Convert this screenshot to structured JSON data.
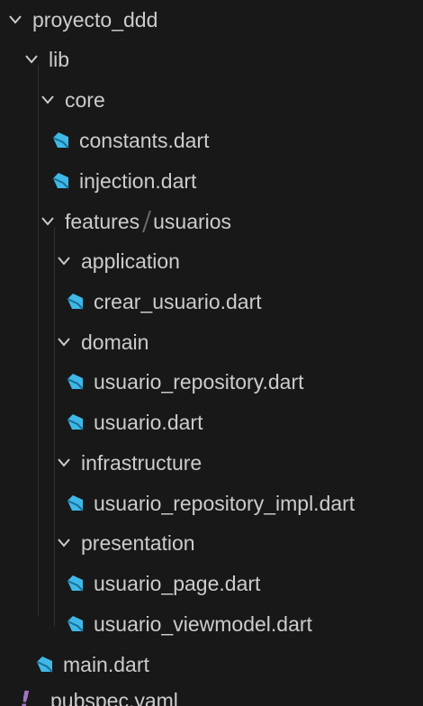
{
  "explorer": {
    "root": {
      "label": "proyecto_ddd"
    },
    "lib": {
      "label": "lib"
    },
    "core": {
      "label": "core"
    },
    "constants": {
      "label": "constants.dart"
    },
    "injection": {
      "label": "injection.dart"
    },
    "features": {
      "label": "features",
      "sub": "usuarios"
    },
    "application": {
      "label": "application"
    },
    "crear_usuario": {
      "label": "crear_usuario.dart"
    },
    "domain": {
      "label": "domain"
    },
    "usuario_repository": {
      "label": "usuario_repository.dart"
    },
    "usuario": {
      "label": "usuario.dart"
    },
    "infrastructure": {
      "label": "infrastructure"
    },
    "usuario_repository_impl": {
      "label": "usuario_repository_impl.dart"
    },
    "presentation": {
      "label": "presentation"
    },
    "usuario_page": {
      "label": "usuario_page.dart"
    },
    "usuario_viewmodel": {
      "label": "usuario_viewmodel.dart"
    },
    "main": {
      "label": "main.dart"
    },
    "pubspec": {
      "label": "pubspec.yaml"
    }
  },
  "icons": {
    "folder_expanded": "chevron-down-icon",
    "dart_file": "dart-file-icon",
    "yaml_file": "yaml-file-icon"
  },
  "colors": {
    "background": "#181818",
    "text": "#cccccc",
    "dart_icon": "#3fb8e8",
    "yaml_icon": "#a074c4",
    "chevron": "#cccccc"
  }
}
